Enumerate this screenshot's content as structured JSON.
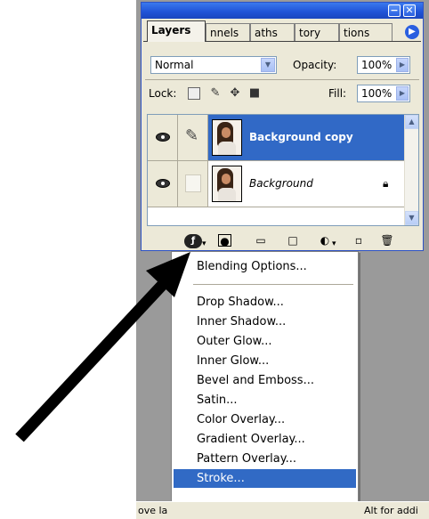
{
  "palette": {
    "tabs": [
      {
        "label": "Layers",
        "active": true
      },
      {
        "label": "nnels"
      },
      {
        "label": "aths"
      },
      {
        "label": "tory"
      },
      {
        "label": "tions"
      }
    ],
    "blend_mode": "Normal",
    "opacity_label": "Opacity:",
    "opacity_value": "100%",
    "lock_label": "Lock:",
    "fill_label": "Fill:",
    "fill_value": "100%",
    "layers": [
      {
        "name": "Background copy",
        "selected": true,
        "visible": true
      },
      {
        "name": "Background",
        "selected": false,
        "visible": true,
        "locked": true
      }
    ]
  },
  "menu": {
    "items": [
      "Blending Options...",
      "Drop Shadow...",
      "Inner Shadow...",
      "Outer Glow...",
      "Inner Glow...",
      "Bevel and Emboss...",
      "Satin...",
      "Color Overlay...",
      "Gradient Overlay...",
      "Pattern Overlay...",
      "Stroke..."
    ],
    "highlighted": "Stroke..."
  },
  "status": {
    "left_text": "ove la",
    "right_text": "Alt for addi"
  },
  "colors": {
    "selection": "#3169c6",
    "menu_highlight": "#316ac5",
    "titlebar": "#1f52d6",
    "arrow": "#000000"
  }
}
